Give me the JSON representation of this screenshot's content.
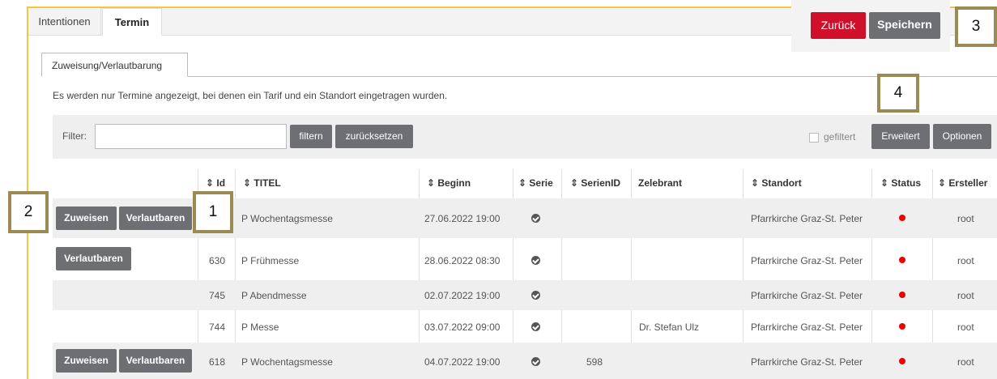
{
  "tabs": [
    {
      "label": "Intentionen"
    },
    {
      "label": "Termin"
    }
  ],
  "actions": {
    "zurueck": "Zurück",
    "speichern": "Speichern"
  },
  "subtab": "Zuweisung/Verlautbarung",
  "info": "Es werden nur Termine angezeigt, bei denen ein Tarif und ein Standort eingetragen wurden.",
  "filter": {
    "label": "Filter:",
    "value": "",
    "filtern": "filtern",
    "reset": "zurücksetzen",
    "gefiltert": "gefiltert",
    "erweitert": "Erweitert",
    "optionen": "Optionen"
  },
  "callouts": {
    "c1": "1",
    "c2": "2",
    "c3": "3",
    "c4": "4"
  },
  "columns": {
    "id": "⇕ Id",
    "titel": "⇕ TITEL",
    "beginn": "⇕ Beginn",
    "serie": "⇕ Serie",
    "serienid": "⇕ SerienID",
    "zelebrant": "Zelebrant",
    "standort": "⇕ Standort",
    "status": "⇕ Status",
    "ersteller": "⇕ Ersteller"
  },
  "rows": [
    {
      "zuweisen": "Zuweisen",
      "verlautbaren": "Verlautbaren",
      "id": "",
      "titel": "P Wochentagsmesse",
      "beginn": "27.06.2022 19:00",
      "serienid": "",
      "zelebrant": "",
      "standort": "Pfarrkirche Graz-St. Peter",
      "ersteller": "root"
    },
    {
      "zuweisen": "",
      "verlautbaren": "Verlautbaren",
      "id": "630",
      "titel": "P Frühmesse",
      "beginn": "28.06.2022 08:30",
      "serienid": "",
      "zelebrant": "",
      "standort": "Pfarrkirche Graz-St. Peter",
      "ersteller": "root"
    },
    {
      "zuweisen": "",
      "verlautbaren": "",
      "id": "745",
      "titel": "P Abendmesse",
      "beginn": "02.07.2022 19:00",
      "serienid": "",
      "zelebrant": "",
      "standort": "Pfarrkirche Graz-St. Peter",
      "ersteller": "root"
    },
    {
      "zuweisen": "",
      "verlautbaren": "",
      "id": "744",
      "titel": "P Messe",
      "beginn": "03.07.2022 09:00",
      "serienid": "",
      "zelebrant": "Dr. Stefan Ulz",
      "standort": "Pfarrkirche Graz-St. Peter",
      "ersteller": "root"
    },
    {
      "zuweisen": "Zuweisen",
      "verlautbaren": "Verlautbaren",
      "id": "618",
      "titel": "P Wochentagsmesse",
      "beginn": "04.07.2022 19:00",
      "serienid": "598",
      "zelebrant": "",
      "standort": "Pfarrkirche Graz-St. Peter",
      "ersteller": "root"
    }
  ],
  "colors": {
    "accent": "#d0102a",
    "button": "#6d6f73",
    "frame": "#f2c744",
    "callout": "#9b8b52",
    "status": "#e00000"
  }
}
